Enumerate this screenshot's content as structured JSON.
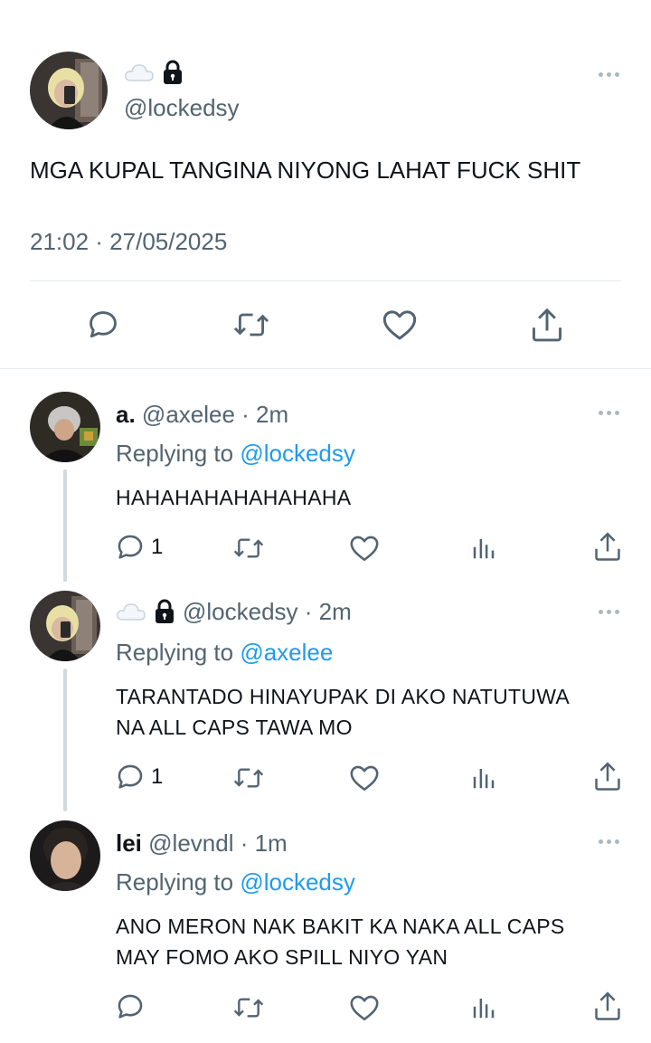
{
  "main_tweet": {
    "display_name_emoji": "☁️",
    "handle": "@lockedsy",
    "text": "MGA KUPAL TANGINA NIYONG LAHAT FUCK SHIT",
    "timestamp": "21:02 · 27/05/2025"
  },
  "replies": [
    {
      "name": "a.",
      "handle_time": "@axelee · 2m",
      "replying_prefix": "Replying to",
      "replying_to": "@lockedsy",
      "lines": [
        "HAHAHAHAHAHAHAHA"
      ],
      "reply_count": "1"
    },
    {
      "name_emoji": "☁️",
      "handle_time": "@lockedsy · 2m",
      "replying_prefix": "Replying to",
      "replying_to": "@axelee",
      "lines": [
        "TARANTADO HINAYUPAK DI AKO NATUTUWA",
        "NA ALL CAPS TAWA MO"
      ],
      "reply_count": "1"
    },
    {
      "name": "lei",
      "handle_time": "@levndl · 1m",
      "replying_prefix": "Replying to",
      "replying_to": "@lockedsy",
      "lines": [
        "ANO MERON NAK BAKIT KA NAKA ALL CAPS",
        "MAY FOMO AKO SPILL NIYO YAN"
      ],
      "reply_count": ""
    }
  ],
  "icons": {
    "reply": "speech-bubble-icon",
    "retweet": "retweet-icon",
    "like": "heart-icon",
    "share": "share-icon",
    "views": "bar-chart-icon",
    "lock": "lock-icon",
    "cloud": "cloud-emoji",
    "more": "more-dots-icon"
  },
  "colors": {
    "text": "#0f1419",
    "secondary": "#536471",
    "link": "#1d9bf0",
    "divider": "#e6ecf0",
    "thread_line": "#cfd9de"
  }
}
